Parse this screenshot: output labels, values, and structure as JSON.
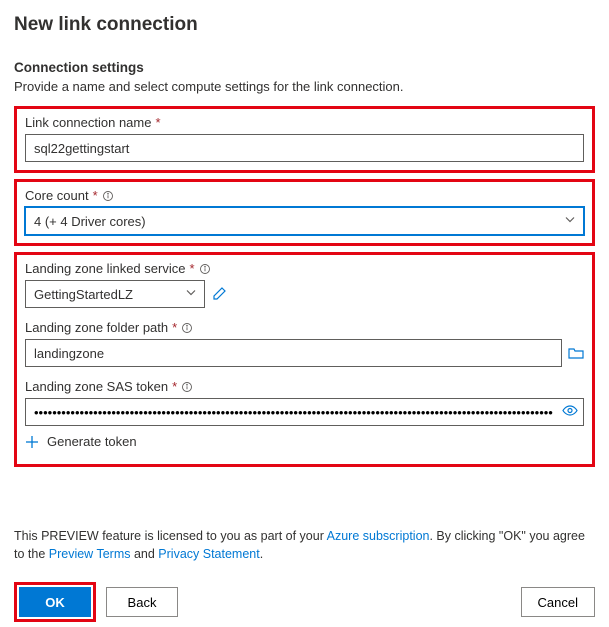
{
  "header": {
    "title": "New link connection"
  },
  "section": {
    "heading": "Connection settings",
    "subtitle": "Provide a name and select compute settings for the link connection."
  },
  "fields": {
    "name": {
      "label": "Link connection name",
      "value": "sql22gettingstart"
    },
    "coreCount": {
      "label": "Core count",
      "value": "4 (+ 4 Driver cores)"
    },
    "lzService": {
      "label": "Landing zone linked service",
      "value": "GettingStartedLZ"
    },
    "lzFolder": {
      "label": "Landing zone folder path",
      "value": "landingzone"
    },
    "sas": {
      "label": "Landing zone SAS token",
      "value": "••••••••••••••••••••••••••••••••••••••••••••••••••••••••••••••••••••••••••••••••••••••••••••••••••••••••••••••••••••…"
    },
    "generateToken": "Generate token"
  },
  "preview": {
    "part1": "This PREVIEW feature is licensed to you as part of your ",
    "link1": "Azure subscription",
    "part2": ". By clicking \"OK\" you agree to the ",
    "link2": "Preview Terms",
    "part3": " and ",
    "link3": "Privacy Statement",
    "part4": "."
  },
  "buttons": {
    "ok": "OK",
    "back": "Back",
    "cancel": "Cancel"
  }
}
